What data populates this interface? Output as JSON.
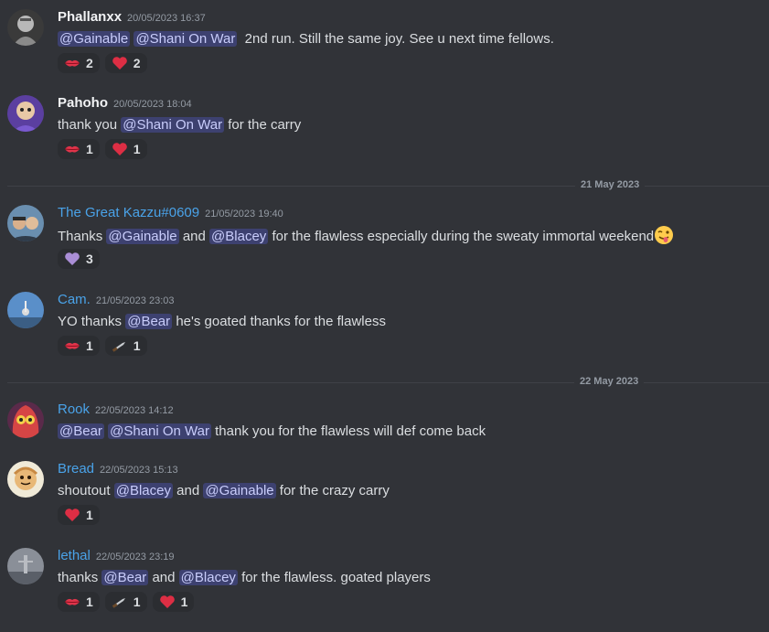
{
  "messages": [
    {
      "username": "Phallanxx",
      "timestamp": "20/05/2023 16:37",
      "mentions": [
        "@Gainable",
        "@Shani On War"
      ],
      "text": "2nd run. Still the same joy. See u next time fellows.",
      "reactions": [
        {
          "emoji": "lips-icon",
          "count": "2"
        },
        {
          "emoji": "red-heart-icon",
          "count": "2"
        }
      ]
    },
    {
      "username": "Pahoho",
      "timestamp": "20/05/2023 18:04",
      "text_before": "thank you",
      "mention": "@Shani On War",
      "text_after": "for the carry",
      "reactions": [
        {
          "emoji": "lips-icon",
          "count": "1"
        },
        {
          "emoji": "red-heart-icon",
          "count": "1"
        }
      ]
    },
    {
      "username": "The Great Kazzu#0609",
      "timestamp": "21/05/2023 19:40",
      "text_before": "Thanks",
      "mention1": "@Gainable",
      "text_mid": "and",
      "mention2": "@Blacey",
      "text_after": "for the flawless especially during the sweaty immortal weekend",
      "inline_emoji": "winking-face-tongue-icon",
      "reactions": [
        {
          "emoji": "purple-heart-icon",
          "count": "3"
        }
      ]
    },
    {
      "username": "Cam.",
      "timestamp": "21/05/2023 23:03",
      "text_before": "YO thanks",
      "mention": "@Bear",
      "text_after": "he's goated thanks for the flawless",
      "reactions": [
        {
          "emoji": "lips-icon",
          "count": "1"
        },
        {
          "emoji": "knife-icon",
          "count": "1"
        }
      ]
    },
    {
      "username": "Rook",
      "timestamp": "22/05/2023 14:12",
      "mentions": [
        "@Bear",
        "@Shani On War"
      ],
      "text": "thank you for the flawless will def come back"
    },
    {
      "username": "Bread",
      "timestamp": "22/05/2023 15:13",
      "text_before": "shoutout",
      "mention1": "@Blacey",
      "text_mid": "and",
      "mention2": "@Gainable",
      "text_after": "for the crazy carry",
      "reactions": [
        {
          "emoji": "red-heart-icon",
          "count": "1"
        }
      ]
    },
    {
      "username": "lethal",
      "timestamp": "22/05/2023 23:19",
      "text_before": "thanks",
      "mention1": "@Bear",
      "text_mid": "and",
      "mention2": "@Blacey",
      "text_after": "for the flawless. goated players",
      "reactions": [
        {
          "emoji": "lips-icon",
          "count": "1"
        },
        {
          "emoji": "knife-icon",
          "count": "1"
        },
        {
          "emoji": "red-heart-icon",
          "count": "1"
        }
      ]
    }
  ],
  "dividers": [
    "21 May 2023",
    "22 May 2023"
  ],
  "colors": {
    "background": "#313338",
    "username_blue": "#4aa3e9",
    "mention_bg": "#3c4270",
    "mention_text": "#c9cdfb",
    "timestamp": "#949ba4"
  }
}
